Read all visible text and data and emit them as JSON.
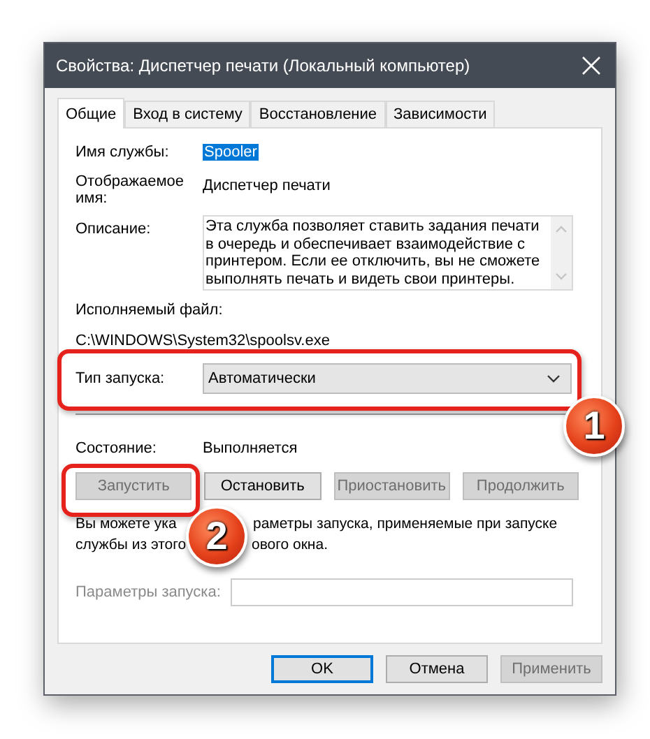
{
  "window": {
    "title": "Свойства: Диспетчер печати (Локальный компьютер)"
  },
  "tabs": [
    {
      "label": "Общие",
      "selected": true
    },
    {
      "label": "Вход в систему",
      "selected": false
    },
    {
      "label": "Восстановление",
      "selected": false
    },
    {
      "label": "Зависимости",
      "selected": false
    }
  ],
  "service_name": {
    "label": "Имя службы:",
    "value": "Spooler",
    "selected": true
  },
  "display_name": {
    "label": "Отображаемое имя:",
    "value": "Диспетчер печати"
  },
  "description": {
    "label": "Описание:",
    "value": "Эта служба позволяет ставить задания печати в очередь и обеспечивает взаимодействие с принтером. Если ее отключить, вы не сможете выполнять печать и видеть свои принтеры."
  },
  "executable": {
    "label": "Исполняемый файл:",
    "value": "C:\\WINDOWS\\System32\\spoolsv.exe"
  },
  "startup_type": {
    "label": "Тип запуска:",
    "value": "Автоматически"
  },
  "status": {
    "label": "Состояние:",
    "value": "Выполняется"
  },
  "service_buttons": [
    {
      "label": "Запустить",
      "disabled": true
    },
    {
      "label": "Остановить",
      "disabled": false
    },
    {
      "label": "Приостановить",
      "disabled": true
    },
    {
      "label": "Продолжить",
      "disabled": true
    }
  ],
  "hint_lines": [
    [
      "Вы можете ука",
      "раметры запуска, применяемые при запуске"
    ],
    [
      "службы из этого",
      "ового окна."
    ]
  ],
  "start_params": {
    "label": "Параметры запуска:",
    "disabled": true
  },
  "dialog_buttons": [
    {
      "label": "OK",
      "disabled": false,
      "default": true
    },
    {
      "label": "Отмена",
      "disabled": false,
      "default": false
    },
    {
      "label": "Применить",
      "disabled": true,
      "default": false
    }
  ],
  "annotations": [
    {
      "label": "1"
    },
    {
      "label": "2"
    }
  ]
}
